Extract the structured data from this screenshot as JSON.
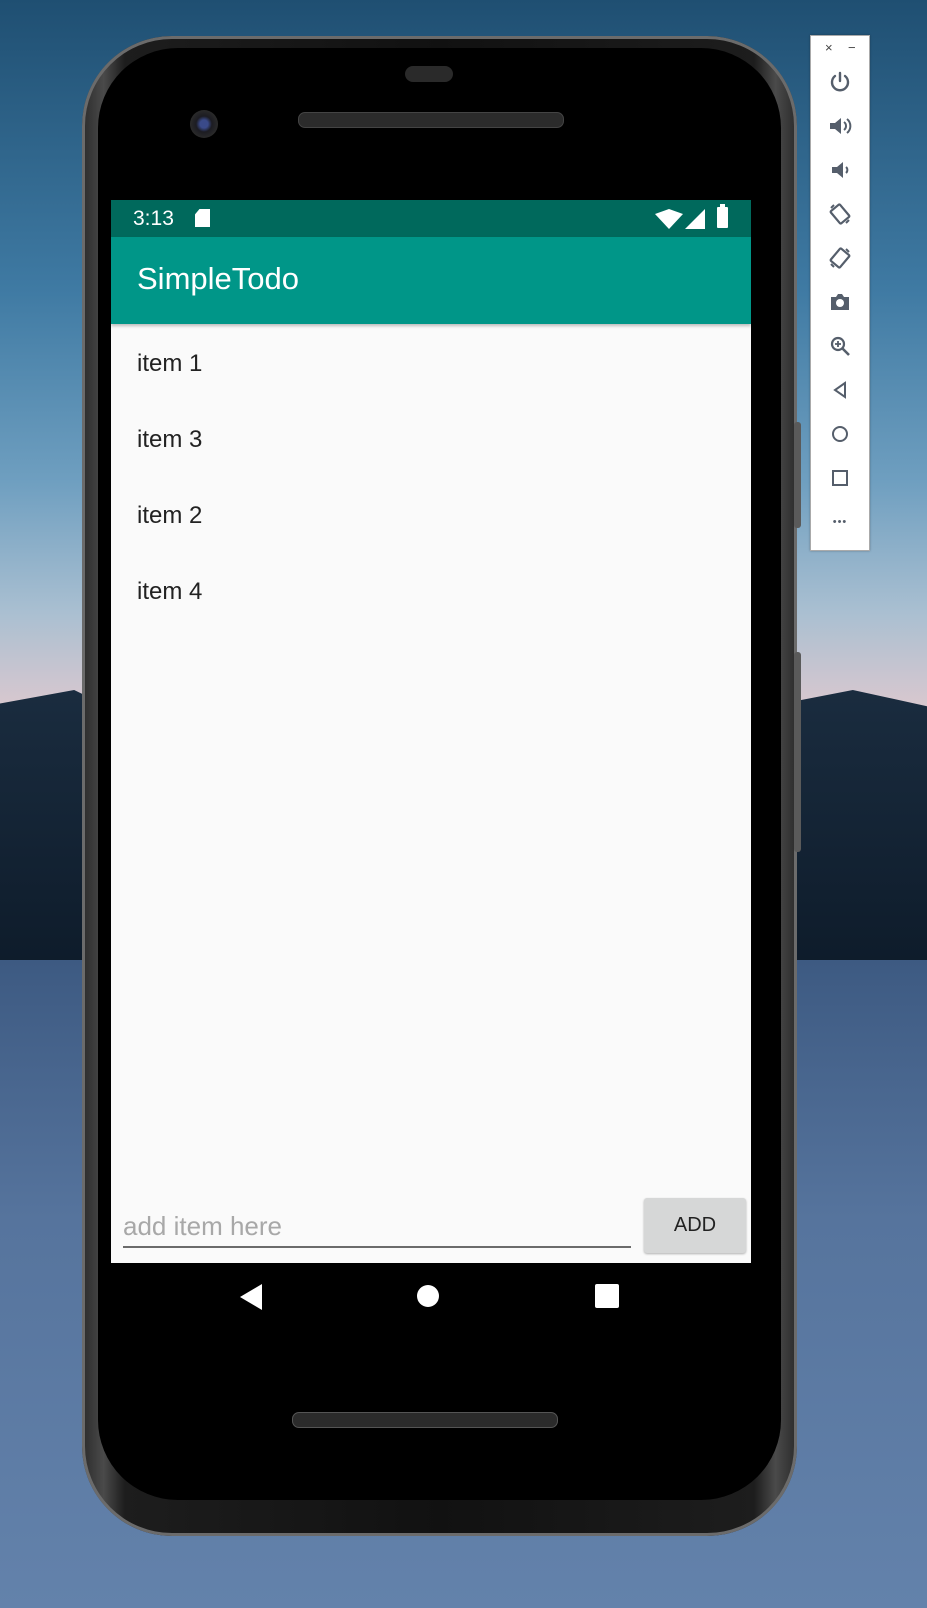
{
  "status_bar": {
    "time": "3:13"
  },
  "app": {
    "title": "SimpleTodo"
  },
  "items": [
    "item 1",
    "item 3",
    "item 2",
    "item 4"
  ],
  "input": {
    "placeholder": "add item here",
    "value": ""
  },
  "add_button": {
    "label": "ADD"
  },
  "emulator_toolbar": {
    "close": "×",
    "minimize": "−",
    "more": "•••"
  },
  "colors": {
    "status_bar": "#00695c",
    "app_bar": "#009688",
    "screen_bg": "#fafafa",
    "button_bg": "#d6d7d7"
  }
}
